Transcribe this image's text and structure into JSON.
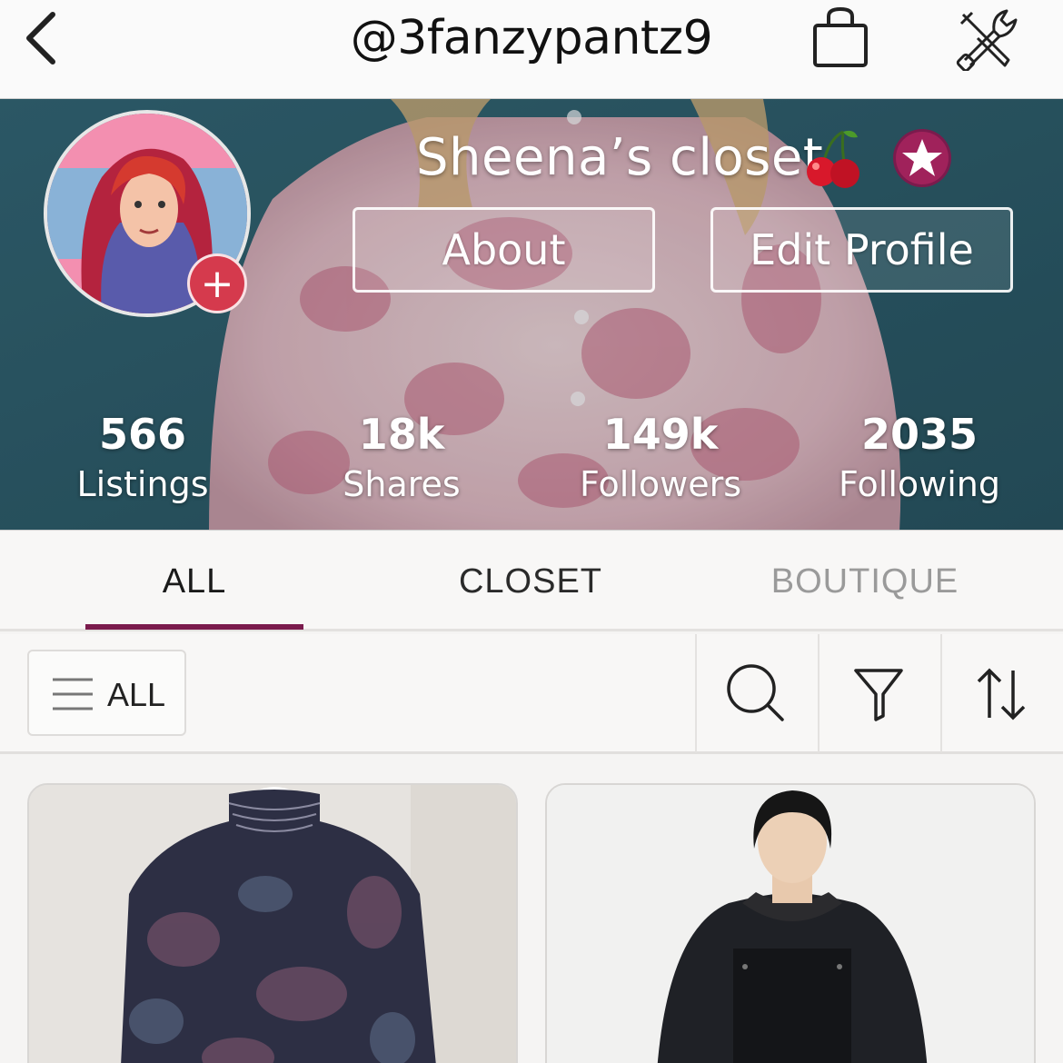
{
  "header": {
    "username": "@3fanzypantz9",
    "icons": [
      "back-chevron-icon",
      "shopping-bag-icon",
      "tools-icon"
    ]
  },
  "profile": {
    "closet_name": "Sheena’s closet",
    "badges": [
      "cherry-icon",
      "ambassador-star-icon"
    ],
    "about_label": "About",
    "edit_profile_label": "Edit Profile",
    "stats": [
      {
        "value": "566",
        "label": "Listings"
      },
      {
        "value": "18k",
        "label": "Shares"
      },
      {
        "value": "149k",
        "label": "Followers"
      },
      {
        "value": "2035",
        "label": "Following"
      }
    ]
  },
  "tabs": [
    {
      "label": "ALL",
      "selected": true
    },
    {
      "label": "CLOSET",
      "selected": false
    },
    {
      "label": "BOUTIQUE",
      "selected": false
    }
  ],
  "filters": {
    "category_label": "ALL",
    "icons": [
      "menu-lines-icon",
      "search-icon",
      "filter-funnel-icon",
      "sort-arrows-icon"
    ]
  },
  "colors": {
    "accent": "#7b1b4d",
    "avatar_add": "#d53a4d",
    "cover_bg": "#2c5a68"
  }
}
